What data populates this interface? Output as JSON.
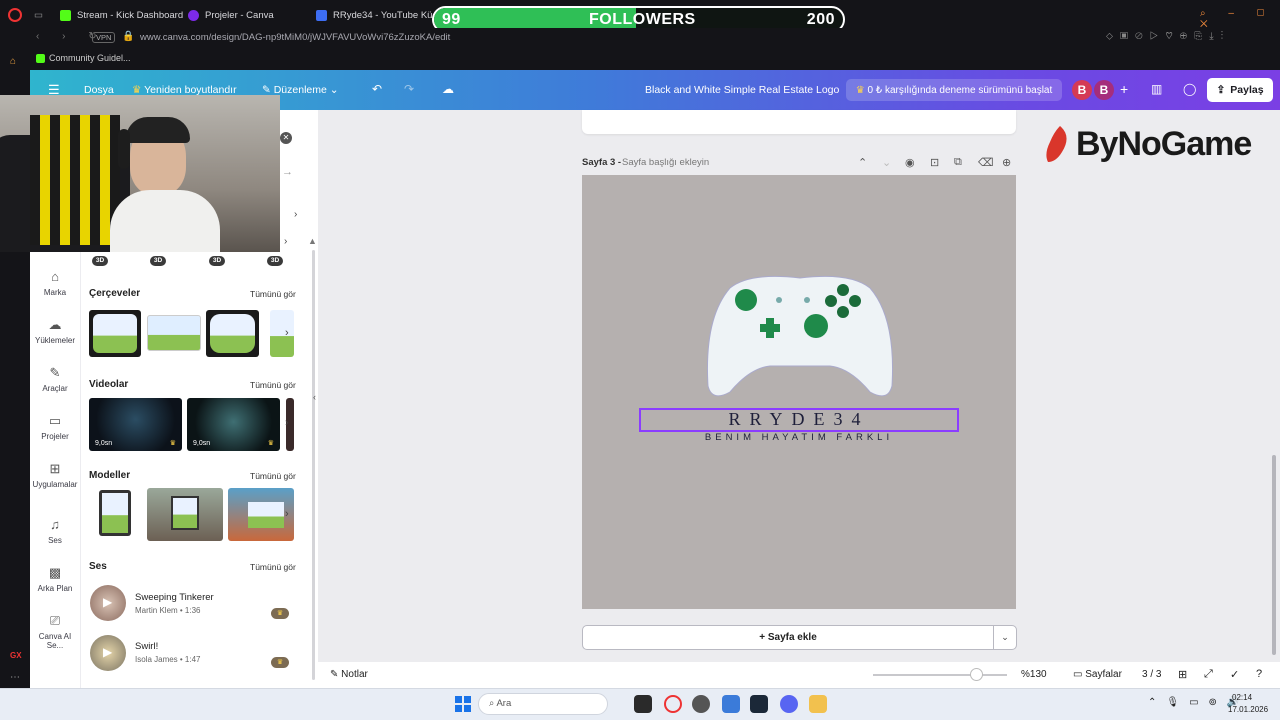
{
  "browser": {
    "tabs": [
      {
        "label": "Stream - Kick Dashboard",
        "color": "#53fc18"
      },
      {
        "label": "Projeler - Canva",
        "color": "#7d2ae8"
      },
      {
        "label": "RRyde34 - YouTube Küçü",
        "color": "#3d6df2"
      }
    ],
    "vpn": "VPN",
    "url": "www.canva.com/design/DAG-np9tMiM0/jWJVFAVUVoWvi76zZuzoKA/edit",
    "bookmark": "Community Guidel..."
  },
  "followers": {
    "current": "99",
    "label": "FOLLOWERS",
    "goal": "200",
    "progress": 0.495
  },
  "canva_header": {
    "menu_file": "Dosya",
    "resize": "Yeniden boyutlandır",
    "edit": "Düzenleme",
    "design_title": "Black and White Simple Real Estate Logo",
    "trial": "0 ₺ karşılığında deneme sürümünü başlat",
    "avatar1": "B",
    "avatar2": "B",
    "share": "Paylaş"
  },
  "rail": [
    {
      "label": "Marka",
      "icon": "brand-icon"
    },
    {
      "label": "Yüklemeler",
      "icon": "upload-cloud-icon"
    },
    {
      "label": "Araçlar",
      "icon": "pen-tool-icon"
    },
    {
      "label": "Projeler",
      "icon": "folder-icon"
    },
    {
      "label": "Uygulamalar",
      "icon": "apps-grid-icon"
    },
    {
      "label": "Ses",
      "icon": "music-note-icon"
    },
    {
      "label": "Arka Plan",
      "icon": "background-icon"
    },
    {
      "label": "Canva AI Se...",
      "icon": "ai-icon"
    }
  ],
  "panel": {
    "badges": [
      "3D",
      "3D",
      "3D",
      "3D"
    ],
    "frames_title": "Çerçeveler",
    "videos_title": "Videolar",
    "models_title": "Modeller",
    "audio_title": "Ses",
    "see_all": "Tümünü gör",
    "videos": [
      {
        "duration": "9,0sn"
      },
      {
        "duration": "9,0sn"
      }
    ],
    "audio": [
      {
        "title": "Sweeping Tinkerer",
        "subtitle": "Martin Klem • 1:36"
      },
      {
        "title": "Swirl!",
        "subtitle": "Isola James • 1:47"
      }
    ]
  },
  "editor": {
    "page_label": "Sayfa 3 -",
    "page_title_placeholder": "Sayfa başlığı ekleyin",
    "brand_name": "RRYDE34",
    "brand_slogan": "BENIM HAYATIM FARKLI",
    "add_page": "+ Sayfa ekle",
    "canvas_color": "#b5b0af"
  },
  "overlay_logo": "ByNoGame",
  "bottom": {
    "notes": "Notlar",
    "zoom": "%130",
    "zoom_level": 1.3,
    "pages": "Sayfalar",
    "page_count": "3 / 3"
  },
  "taskbar": {
    "search": "Ara",
    "time": "02:14",
    "date": "17.01.2026"
  }
}
